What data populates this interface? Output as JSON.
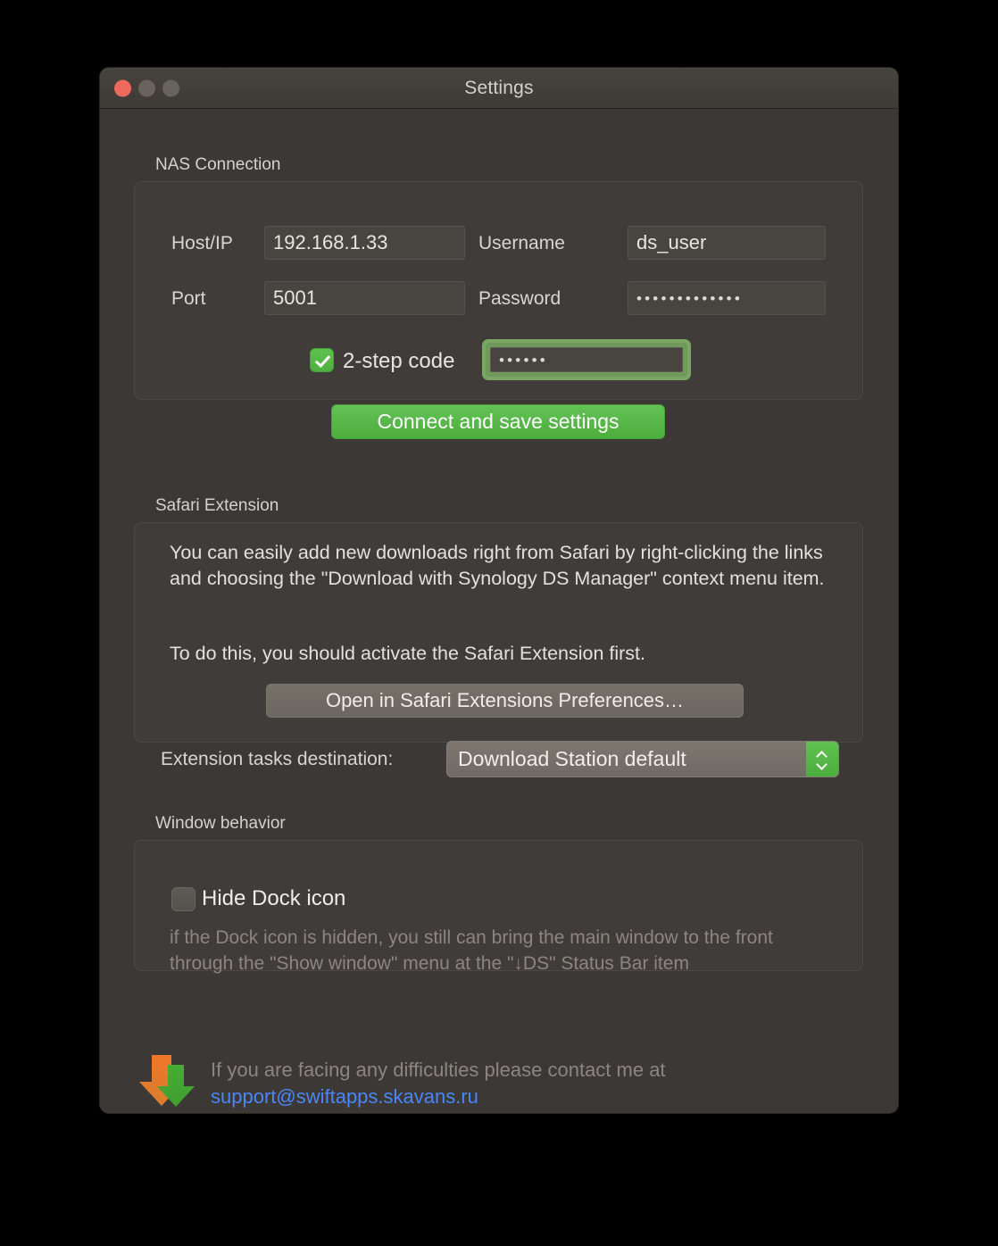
{
  "window": {
    "title": "Settings",
    "traffic_lights": [
      "close-button",
      "minimize-button",
      "zoom-button"
    ]
  },
  "nas_connection": {
    "group_label": "NAS Connection",
    "host_label": "Host/IP",
    "host_value": "192.168.1.33",
    "username_label": "Username",
    "username_value": "ds_user",
    "port_label": "Port",
    "port_value": "5001",
    "password_label": "Password",
    "password_value": "•••••••••••••",
    "two_step_label": "2-step code",
    "two_step_checked": true,
    "two_step_value": "••••••",
    "connect_button": "Connect and save settings"
  },
  "safari_extension": {
    "group_label": "Safari Extension",
    "paragraph_1": "You can easily add new downloads right from Safari by right-clicking the links and choosing the \"Download with Synology DS Manager\" context menu item.",
    "paragraph_2": "To do this, you should activate the Safari Extension first.",
    "open_prefs_button": "Open in Safari Extensions Preferences…",
    "destination_label": "Extension tasks destination:",
    "destination_value": "Download Station default"
  },
  "window_behavior": {
    "group_label": "Window behavior",
    "hide_dock_label": "Hide Dock icon",
    "hide_dock_checked": false,
    "hint": "if the Dock icon is hidden, you still can bring the main window to the front through the \"Show window\" menu at the \"↓DS\" Status Bar item"
  },
  "footer": {
    "message": "If you are facing any difficulties please contact me at",
    "email": "support@swiftapps.skavans.ru"
  },
  "colors": {
    "window_bg": "#3b3835",
    "accent_green": "#52b341",
    "link_blue": "#4a86f7",
    "arrow_orange": "#e8762c",
    "arrow_green": "#3fa52f",
    "close_red": "#ee6a5c"
  }
}
